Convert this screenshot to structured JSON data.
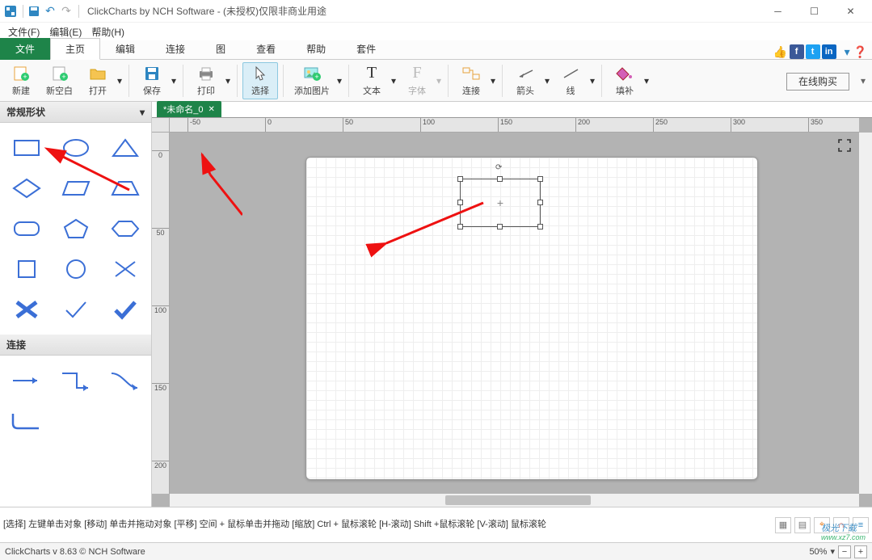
{
  "titlebar": {
    "app_name": "ClickCharts by NCH Software",
    "suffix": "- (未授权)仅限非商业用途"
  },
  "menubar": {
    "file": "文件(F)",
    "edit": "编辑(E)",
    "help": "帮助(H)"
  },
  "ribbon_tabs": {
    "file": "文件",
    "home": "主页",
    "edit": "编辑",
    "connect": "连接",
    "chart": "图",
    "view": "查看",
    "help": "帮助",
    "suite": "套件"
  },
  "ribbon": {
    "new": "新建",
    "new_blank": "新空白",
    "open": "打开",
    "save": "保存",
    "print": "打印",
    "select": "选择",
    "add_image": "添加图片",
    "text": "文本",
    "font": "字体",
    "connect": "连接",
    "arrow": "箭头",
    "line": "线",
    "fill": "填补",
    "buy": "在线购买"
  },
  "shape_panel": {
    "header": "常规形状",
    "connect_header": "连接"
  },
  "document": {
    "tab_name": "*未命名_0"
  },
  "ruler_h": [
    "-50",
    "0",
    "50",
    "100",
    "150",
    "200",
    "250",
    "300",
    "350"
  ],
  "ruler_v": [
    "0",
    "50",
    "100",
    "150",
    "200"
  ],
  "hint": "[选择] 左键单击对象 [移动] 单击并拖动对象 [平移] 空间 + 鼠标单击并拖动 [缩放] Ctrl + 鼠标滚轮 [H-滚动] Shift +鼠标滚轮 [V-滚动] 鼠标滚轮",
  "status": {
    "version": "ClickCharts v 8.63 © NCH Software",
    "zoom": "50%"
  },
  "watermark": {
    "main": "极光下载",
    "sub": "www.xz7.com"
  }
}
